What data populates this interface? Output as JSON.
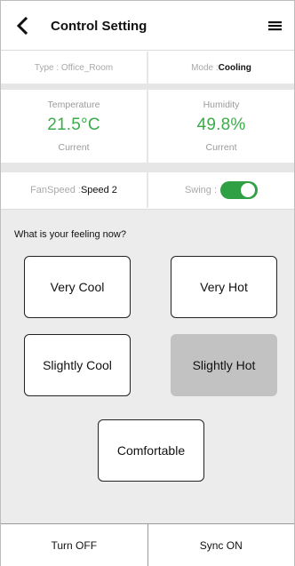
{
  "header": {
    "title": "Control Setting",
    "back_icon": "chevron-left-icon",
    "menu_icon": "hamburger-menu-icon"
  },
  "info": {
    "type_label": "Type : Office_Room",
    "mode_label": "Mode : ",
    "mode_value": "Cooling"
  },
  "readings": {
    "temperature": {
      "label": "Temperature",
      "value": "21.5°C",
      "sub": "Current"
    },
    "humidity": {
      "label": "Humidity",
      "value": "49.8%",
      "sub": "Current"
    }
  },
  "controls": {
    "fan_label": "FanSpeed : ",
    "fan_value": "Speed 2",
    "swing_label": "Swing : ",
    "swing_on": true
  },
  "feeling": {
    "question": "What is your feeling now?",
    "options": [
      "Very Cool",
      "Very Hot",
      "Slightly Cool",
      "Slightly Hot",
      "Comfortable"
    ],
    "selected": "Slightly Hot"
  },
  "bottom": {
    "turn_off": "Turn OFF",
    "sync_on": "Sync ON"
  },
  "colors": {
    "accent_green": "#3cab4b",
    "toggle_green": "#2fa043",
    "panel_gray": "#ececec",
    "selected_gray": "#c2c2c2"
  }
}
